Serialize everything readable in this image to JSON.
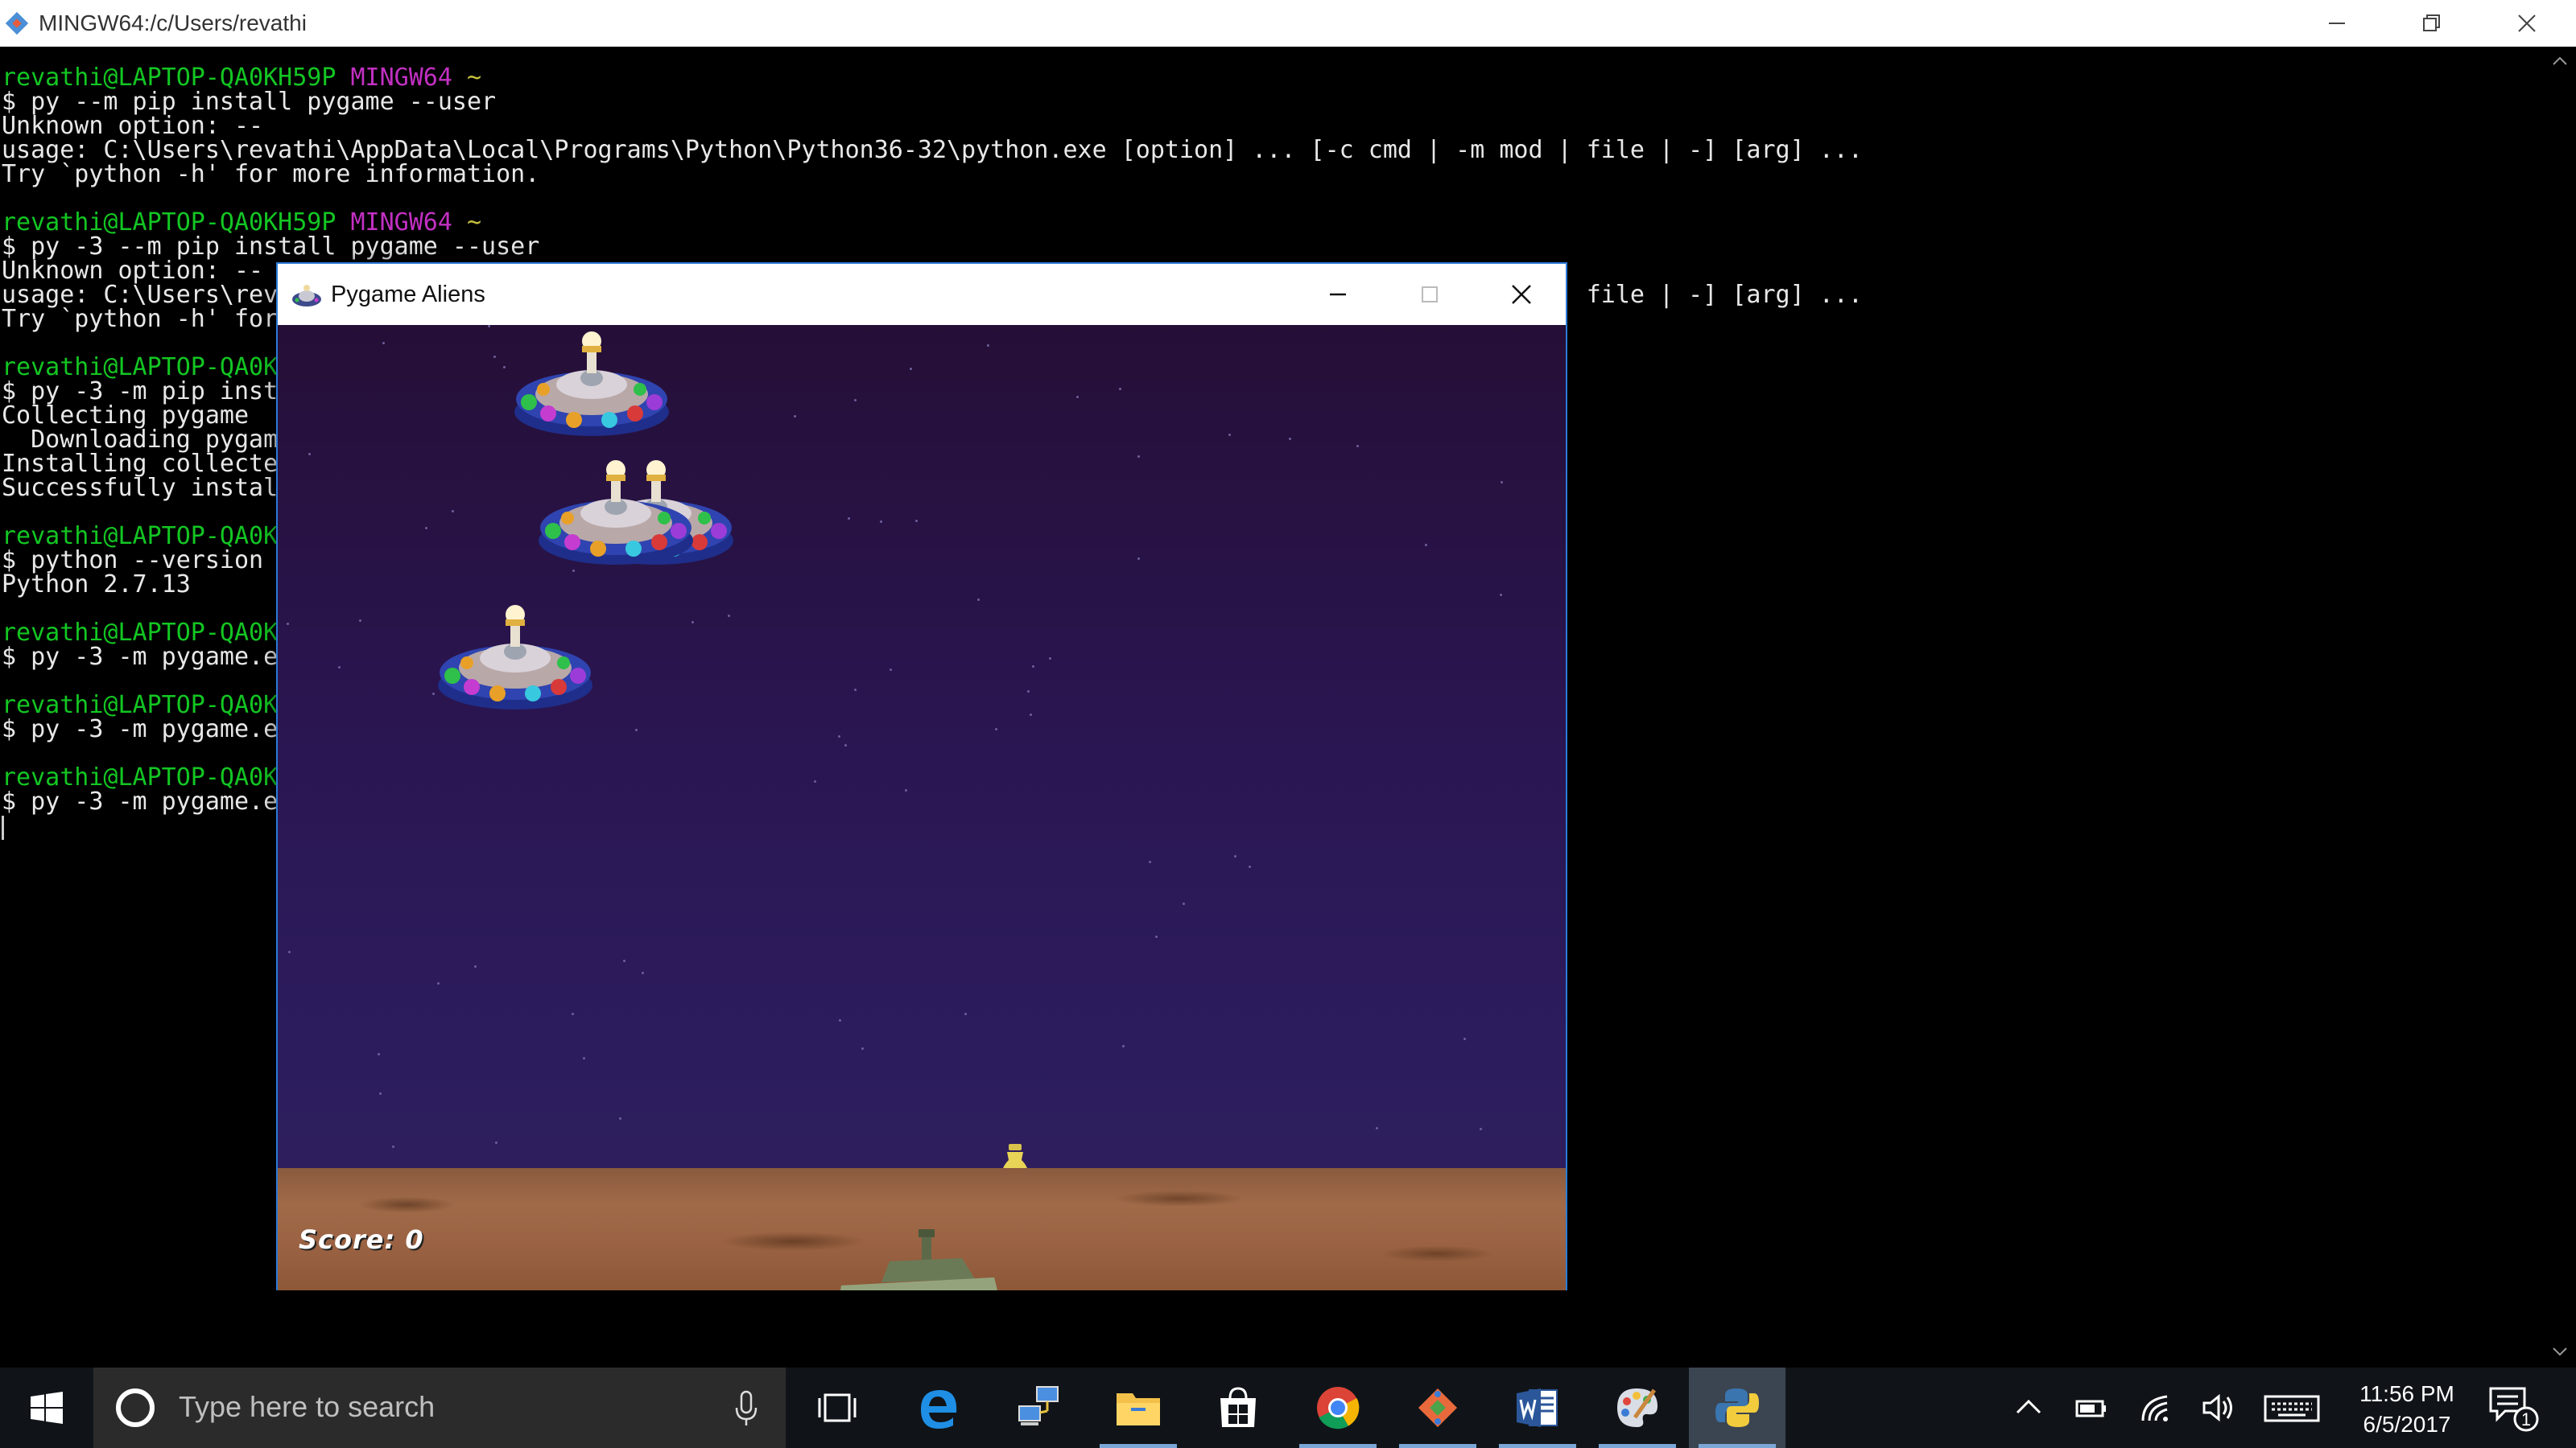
{
  "terminal": {
    "title": "MINGW64:/c/Users/revathi",
    "lines": [
      {
        "segs": [
          {
            "t": "revathi@LAPTOP-QA0KH59P ",
            "c": "green"
          },
          {
            "t": "MINGW64 ",
            "c": "mag"
          },
          {
            "t": "~",
            "c": "yel"
          }
        ]
      },
      {
        "segs": [
          {
            "t": "$ py --m pip install pygame --user",
            "c": ""
          }
        ]
      },
      {
        "segs": [
          {
            "t": "Unknown option: --",
            "c": ""
          }
        ]
      },
      {
        "segs": [
          {
            "t": "usage: C:\\Users\\revathi\\AppData\\Local\\Programs\\Python\\Python36-32\\python.exe [option] ... [-c cmd | -m mod | file | -] [arg] ...",
            "c": ""
          }
        ]
      },
      {
        "segs": [
          {
            "t": "Try `python -h' for more information.",
            "c": ""
          }
        ]
      },
      {
        "segs": [
          {
            "t": "",
            "c": ""
          }
        ]
      },
      {
        "segs": [
          {
            "t": "revathi@LAPTOP-QA0KH59P ",
            "c": "green"
          },
          {
            "t": "MINGW64 ",
            "c": "mag"
          },
          {
            "t": "~",
            "c": "yel"
          }
        ]
      },
      {
        "segs": [
          {
            "t": "$ py -3 --m pip install pygame --user",
            "c": ""
          }
        ]
      },
      {
        "segs": [
          {
            "t": "Unknown option: --",
            "c": ""
          }
        ]
      },
      {
        "segs": [
          {
            "t": "usage: C:\\Users\\revathi\\AppData\\Local\\Programs\\Python\\Python36-32\\python.exe [option] ... [-c cmd | -m mod | file | -] [arg] ...",
            "c": ""
          }
        ]
      },
      {
        "segs": [
          {
            "t": "Try `python -h' for more information.",
            "c": ""
          }
        ]
      },
      {
        "segs": [
          {
            "t": "",
            "c": ""
          }
        ]
      },
      {
        "segs": [
          {
            "t": "revathi@LAPTOP-QA0K",
            "c": "green"
          }
        ]
      },
      {
        "segs": [
          {
            "t": "$ py -3 -m pip inst",
            "c": ""
          }
        ]
      },
      {
        "segs": [
          {
            "t": "Collecting pygame",
            "c": ""
          }
        ]
      },
      {
        "segs": [
          {
            "t": "  Downloading pygam",
            "c": ""
          }
        ]
      },
      {
        "segs": [
          {
            "t": "Installing collecte",
            "c": ""
          }
        ]
      },
      {
        "segs": [
          {
            "t": "Successfully instal",
            "c": ""
          }
        ]
      },
      {
        "segs": [
          {
            "t": "",
            "c": ""
          }
        ]
      },
      {
        "segs": [
          {
            "t": "revathi@LAPTOP-QA0K",
            "c": "green"
          }
        ]
      },
      {
        "segs": [
          {
            "t": "$ python --version",
            "c": ""
          }
        ]
      },
      {
        "segs": [
          {
            "t": "Python 2.7.13",
            "c": ""
          }
        ]
      },
      {
        "segs": [
          {
            "t": "",
            "c": ""
          }
        ]
      },
      {
        "segs": [
          {
            "t": "revathi@LAPTOP-QA0K",
            "c": "green"
          }
        ]
      },
      {
        "segs": [
          {
            "t": "$ py -3 -m pygame.e",
            "c": ""
          }
        ]
      },
      {
        "segs": [
          {
            "t": "",
            "c": ""
          }
        ]
      },
      {
        "segs": [
          {
            "t": "revathi@LAPTOP-QA0K",
            "c": "green"
          }
        ]
      },
      {
        "segs": [
          {
            "t": "$ py -3 -m pygame.e",
            "c": ""
          }
        ]
      },
      {
        "segs": [
          {
            "t": "",
            "c": ""
          }
        ]
      },
      {
        "segs": [
          {
            "t": "revathi@LAPTOP-QA0K",
            "c": "green"
          }
        ]
      },
      {
        "segs": [
          {
            "t": "$ py -3 -m pygame.e",
            "c": ""
          }
        ]
      }
    ]
  },
  "game": {
    "title": "Pygame Aliens",
    "score_text": "Score: 0"
  },
  "taskbar": {
    "search_placeholder": "Type here to search",
    "apps": [
      "task-view",
      "edge",
      "network",
      "file-explorer",
      "store",
      "chrome",
      "git",
      "word",
      "paint",
      "python"
    ],
    "active_app": "python",
    "time": "11:56 PM",
    "date": "6/5/2017",
    "notification_count": "1"
  },
  "colors": {
    "prompt_user": "#13c623",
    "prompt_host": "#c230c2",
    "prompt_path": "#c8c03c",
    "window_accent": "#2b7bd6"
  }
}
